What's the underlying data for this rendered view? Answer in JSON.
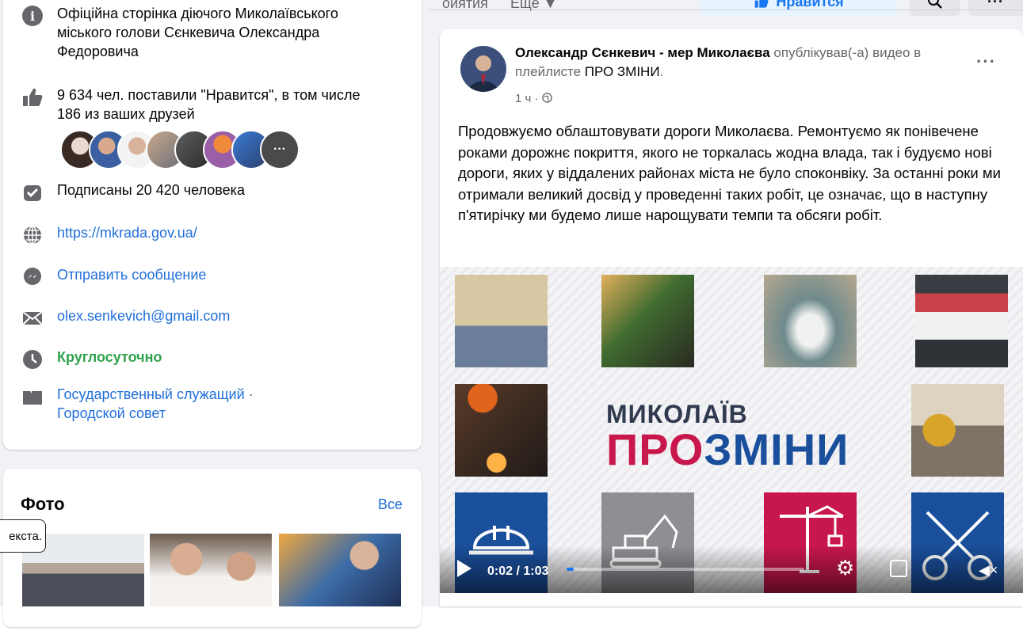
{
  "about": {
    "description": "Офіційна сторінка діючого Миколаївського міського голови Сєнкевича Олександра Федоровича",
    "likes": "9 634 чел. поставили \"Нравится\", в том числе 186 из ваших друзей",
    "followers": "Подписаны 20 420 человека",
    "website": "https://mkrada.gov.ua/",
    "message": "Отправить сообщение",
    "email": "olex.senkevich@gmail.com",
    "hours": "Круглосуточно",
    "category_1": "Государственный служащий",
    "category_sep": " · ",
    "category_2": "Городской совет",
    "friends_more": "···"
  },
  "photos": {
    "title": "Фото",
    "all_link": "Все"
  },
  "tooltip": "екста.",
  "topbar": {
    "tab_events_partial": "оиятия",
    "more_tab": "Еще ▼",
    "like_button": "Нравится",
    "dots": "···"
  },
  "post": {
    "author": "Олександр Сєнкевич - мер Миколаєва",
    "action": " опублікував(-а) видео в плейлисте ",
    "playlist": "ПРО ЗМІНИ",
    "period": ".",
    "time": "1 ч · ",
    "text": "Продовжуємо облаштовувати дороги Миколаєва. Ремонтуємо як понівечене роками дорожнє покриття, якого не торкалась жодна влада, так і будуємо нові дороги, яких у віддалених районах міста не було споконвіку. За останні роки ми отримали великий досвід у проведенні таких робіт, це означає, що в наступну п'ятирічку ми будемо лише нарощувати темпи та обсяги робіт."
  },
  "video": {
    "logo_line1": "МИКОЛАЇВ",
    "logo_pro": "ПРО",
    "logo_zmini": "ЗМІНИ",
    "time": "0:02 / 1:03",
    "progress": 0.03
  },
  "colors": {
    "link": "#216fdb",
    "accent": "#1877f2",
    "green": "#31a24c",
    "pro_red": "#c8174c",
    "zmini_blue": "#1a4f9c"
  }
}
